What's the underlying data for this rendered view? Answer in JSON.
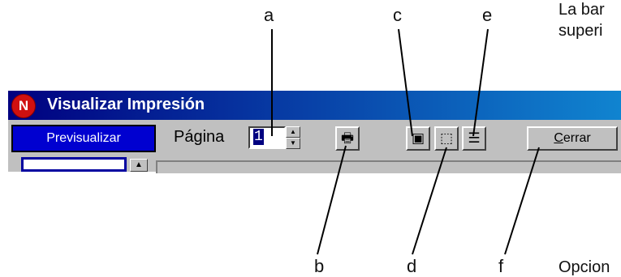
{
  "window": {
    "title": "Visualizar Impresión",
    "app_icon_glyph": "N"
  },
  "toolbar": {
    "preview_label": "Previsualizar",
    "page_label": "Página",
    "page_value": "1",
    "spin_up": "▲",
    "spin_down": "▼",
    "print_icon": "🖶",
    "view_one_icon": "▣",
    "view_fit_icon": "⬚",
    "view_list_icon": "☰",
    "close_label_prefix": "C",
    "close_label_rest": "errar"
  },
  "content": {
    "scroll_up_glyph": "▲"
  },
  "callouts": {
    "a": "a",
    "b": "b",
    "c": "c",
    "d": "d",
    "e": "e",
    "f": "f"
  },
  "side_text": {
    "top_line1": "La bar",
    "top_line2": "superi",
    "bottom_line1": "Opcion"
  },
  "colors": {
    "title_bar_start": "#000080",
    "title_bar_end": "#1084d0",
    "face": "#c0c0c0",
    "preview_button": "#0000d0"
  }
}
